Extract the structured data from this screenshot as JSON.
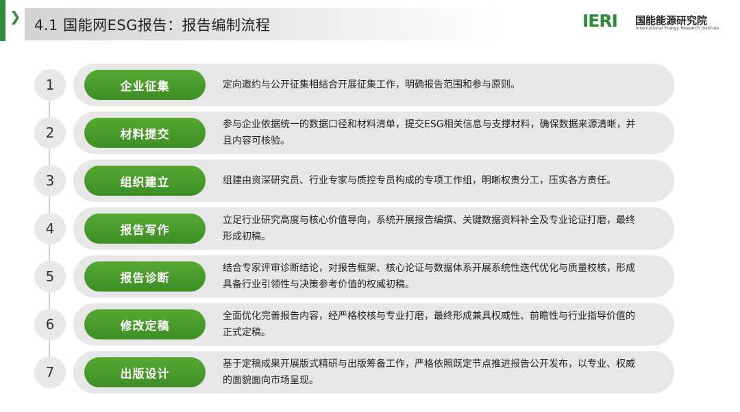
{
  "header": {
    "chevron_icon": "chevron-right-icon",
    "title": "4.1 国能网ESG报告：报告编制流程"
  },
  "logo": {
    "mark": "IERI",
    "name_cn": "国能能源研究院",
    "name_en": "International Energy Research Institute"
  },
  "colors": {
    "accent_green": "#2e8b3a",
    "pill_green": "#4a9e2c",
    "bar_gray": "#e7e7e7"
  },
  "steps": [
    {
      "number": "1",
      "label": "企业征集",
      "description": "定向邀约与公开征集相结合开展征集工作，明确报告范围和参与原则。"
    },
    {
      "number": "2",
      "label": "材料提交",
      "description": "参与企业依据统一的数据口径和材料清单，提交ESG相关信息与支撑材料，确保数据来源清晰，并且内容可核验。"
    },
    {
      "number": "3",
      "label": "组织建立",
      "description": "组建由资深研究员、行业专家与质控专员构成的专项工作组，明晰权责分工，压实各方责任。"
    },
    {
      "number": "4",
      "label": "报告写作",
      "description": "立足行业研究高度与核心价值导向，系统开展报告编撰、关键数据资料补全及专业论证打磨，最终形成初稿。"
    },
    {
      "number": "5",
      "label": "报告诊断",
      "description": "结合专家评审诊断结论，对报告框架、核心论证与数据体系开展系统性迭代优化与质量校核，形成具备行业引领性与决策参考价值的权威初稿。"
    },
    {
      "number": "6",
      "label": "修改定稿",
      "description": "全面优化完善报告内容，经严格校核与专业打磨，最终形成兼具权威性、前瞻性与行业指导价值的正式定稿。"
    },
    {
      "number": "7",
      "label": "出版设计",
      "description": "基于定稿成果开展版式精研与出版筹备工作，严格依照既定节点推进报告公开发布，以专业、权威的面貌面向市场呈现。"
    }
  ]
}
